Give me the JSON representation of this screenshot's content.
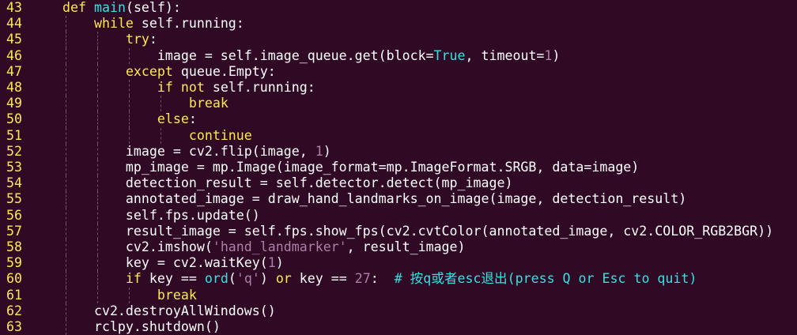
{
  "editor": {
    "lines": [
      {
        "num": "43",
        "tokens": [
          {
            "t": "def",
            "c": "kw"
          },
          {
            "t": " ",
            "c": "txt"
          },
          {
            "t": "main",
            "c": "fn"
          },
          {
            "t": "(self):",
            "c": "txt"
          }
        ]
      },
      {
        "num": "44",
        "tokens": [
          {
            "t": "    ",
            "c": "txt"
          },
          {
            "t": "while",
            "c": "kw"
          },
          {
            "t": " self.running:",
            "c": "txt"
          }
        ]
      },
      {
        "num": "45",
        "tokens": [
          {
            "t": "        ",
            "c": "txt"
          },
          {
            "t": "try",
            "c": "kw"
          },
          {
            "t": ":",
            "c": "txt"
          }
        ]
      },
      {
        "num": "46",
        "tokens": [
          {
            "t": "            image = self.image_queue.get(block=",
            "c": "txt"
          },
          {
            "t": "True",
            "c": "fn"
          },
          {
            "t": ", timeout=",
            "c": "txt"
          },
          {
            "t": "1",
            "c": "num"
          },
          {
            "t": ")",
            "c": "txt"
          }
        ]
      },
      {
        "num": "47",
        "tokens": [
          {
            "t": "        ",
            "c": "txt"
          },
          {
            "t": "except",
            "c": "kw"
          },
          {
            "t": " queue.Empty:",
            "c": "txt"
          }
        ]
      },
      {
        "num": "48",
        "tokens": [
          {
            "t": "            ",
            "c": "txt"
          },
          {
            "t": "if",
            "c": "kw"
          },
          {
            "t": " ",
            "c": "txt"
          },
          {
            "t": "not",
            "c": "kw"
          },
          {
            "t": " self.running:",
            "c": "txt"
          }
        ]
      },
      {
        "num": "49",
        "tokens": [
          {
            "t": "                ",
            "c": "txt"
          },
          {
            "t": "break",
            "c": "kw"
          }
        ]
      },
      {
        "num": "50",
        "tokens": [
          {
            "t": "            ",
            "c": "txt"
          },
          {
            "t": "else",
            "c": "kw"
          },
          {
            "t": ":",
            "c": "txt"
          }
        ]
      },
      {
        "num": "51",
        "tokens": [
          {
            "t": "                ",
            "c": "txt"
          },
          {
            "t": "continue",
            "c": "kw"
          }
        ]
      },
      {
        "num": "52",
        "tokens": [
          {
            "t": "        image = cv2.flip(image, ",
            "c": "txt"
          },
          {
            "t": "1",
            "c": "num"
          },
          {
            "t": ")",
            "c": "txt"
          }
        ]
      },
      {
        "num": "53",
        "tokens": [
          {
            "t": "        mp_image = mp.Image(image_format=mp.ImageFormat.SRGB, data=image)",
            "c": "txt"
          }
        ]
      },
      {
        "num": "54",
        "tokens": [
          {
            "t": "        detection_result = self.detector.detect(mp_image)",
            "c": "txt"
          }
        ]
      },
      {
        "num": "55",
        "tokens": [
          {
            "t": "        annotated_image = draw_hand_landmarks_on_image(image, detection_result)",
            "c": "txt"
          }
        ]
      },
      {
        "num": "56",
        "tokens": [
          {
            "t": "        self.fps.update()",
            "c": "txt"
          }
        ]
      },
      {
        "num": "57",
        "tokens": [
          {
            "t": "        result_image = self.fps.show_fps(cv2.cvtColor(annotated_image, cv2.COLOR_RGB2BGR))",
            "c": "txt"
          }
        ]
      },
      {
        "num": "58",
        "tokens": [
          {
            "t": "        cv2.imshow(",
            "c": "txt"
          },
          {
            "t": "'hand_landmarker'",
            "c": "str"
          },
          {
            "t": ", result_image)",
            "c": "txt"
          }
        ]
      },
      {
        "num": "59",
        "tokens": [
          {
            "t": "        key = cv2.waitKey(",
            "c": "txt"
          },
          {
            "t": "1",
            "c": "num"
          },
          {
            "t": ")",
            "c": "txt"
          }
        ]
      },
      {
        "num": "60",
        "tokens": [
          {
            "t": "        ",
            "c": "txt"
          },
          {
            "t": "if",
            "c": "kw"
          },
          {
            "t": " key == ",
            "c": "txt"
          },
          {
            "t": "ord",
            "c": "fn"
          },
          {
            "t": "(",
            "c": "txt"
          },
          {
            "t": "'q'",
            "c": "str"
          },
          {
            "t": ") ",
            "c": "txt"
          },
          {
            "t": "or",
            "c": "kw"
          },
          {
            "t": " key == ",
            "c": "txt"
          },
          {
            "t": "27",
            "c": "num"
          },
          {
            "t": ":  ",
            "c": "txt"
          },
          {
            "t": "# 按q或者esc退出(press Q or Esc to quit)",
            "c": "cm"
          }
        ]
      },
      {
        "num": "61",
        "tokens": [
          {
            "t": "            ",
            "c": "txt"
          },
          {
            "t": "break",
            "c": "kw"
          }
        ]
      },
      {
        "num": "62",
        "tokens": [
          {
            "t": "    cv2.destroyAllWindows()",
            "c": "txt"
          }
        ]
      },
      {
        "num": "63",
        "tokens": [
          {
            "t": "    rclpy.shutdown()",
            "c": "txt"
          }
        ]
      }
    ]
  },
  "colors": {
    "background": "#300a24",
    "keyword": "#fce94f",
    "builtin": "#34e2e2",
    "number": "#ad7fa8",
    "string": "#ad7fa8",
    "comment": "#34e2e2",
    "line_number": "#fce94f",
    "text": "#ffffff"
  }
}
